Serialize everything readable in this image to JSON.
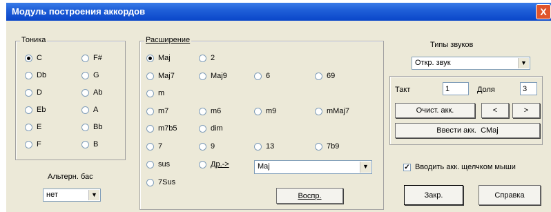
{
  "window": {
    "title": "Модуль построения аккордов",
    "close_label": "X"
  },
  "tonic": {
    "legend": "Тоника",
    "notes": [
      "C",
      "F#",
      "Db",
      "G",
      "D",
      "Ab",
      "Eb",
      "A",
      "E",
      "Bb",
      "F",
      "B"
    ],
    "selected": "C"
  },
  "alt_bass": {
    "label": "Альтерн. бас",
    "value": "нет"
  },
  "extension": {
    "legend": "Расширение",
    "items": [
      "Maj",
      "2",
      "Maj7",
      "Maj9",
      "6",
      "69",
      "m",
      "m7",
      "m6",
      "m9",
      "mMaj7",
      "m7b5",
      "dim",
      "7",
      "9",
      "13",
      "7b9",
      "sus",
      "Др.->",
      "7Sus"
    ],
    "selected": "Maj",
    "other_select_value": "Maj",
    "play_label": "Воспр."
  },
  "sound": {
    "label": "Типы звуков",
    "value": "Откр. звук"
  },
  "position": {
    "bar_label": "Такт",
    "bar_value": "1",
    "beat_label": "Доля",
    "beat_value": "3",
    "clear_label": "Очист. акк.",
    "prev_label": "<",
    "next_label": ">",
    "enter_label": "Ввести акк.  CMaj"
  },
  "mouse_click": {
    "label": "Вводить акк. щелчком мыши",
    "checked": true
  },
  "footer": {
    "close_label": "Закр.",
    "help_label": "Справка"
  }
}
